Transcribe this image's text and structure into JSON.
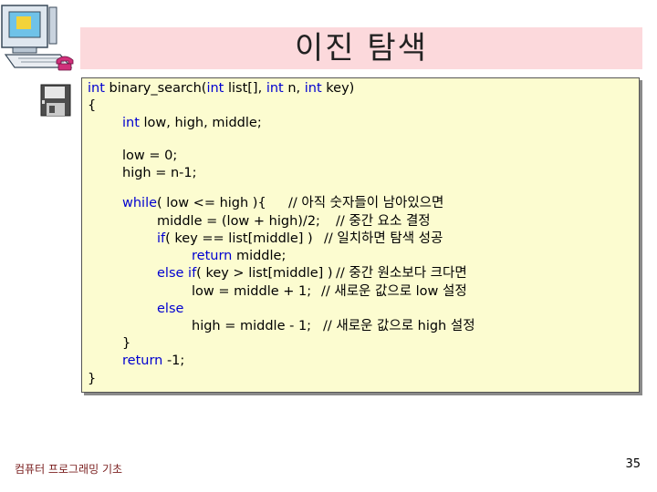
{
  "slide": {
    "title": "이진 탐색",
    "footer": "컴퓨터 프로그래밍 기초",
    "page_number": "35",
    "accent_color": "#fcd9dc",
    "code_bg_color": "#fcfcd0"
  },
  "icons": [
    "computer-icon",
    "phone-icon",
    "floppy-disk-icon"
  ],
  "code": {
    "l1_kw1": "int",
    "l1_a": " binary_search(",
    "l1_kw2": "int",
    "l1_b": " list[], ",
    "l1_kw3": "int",
    "l1_c": " n, ",
    "l1_kw4": "int",
    "l1_d": " key)",
    "l2": "{",
    "l3_kw": "int",
    "l3_a": " low, high, middle;",
    "l4": "low = 0;",
    "l5": "high = n-1;",
    "l6_kw": "while",
    "l6_a": "( low <= high ){",
    "l6_c": "// 아직 숫자들이 남아있으면",
    "l7_a": "middle = (low + high)/2;",
    "l7_c": "// 중간 요소 결정",
    "l8_kw": "if",
    "l8_a": "( key == list[middle] )",
    "l8_c": "// 일치하면 탐색 성공",
    "l9_kw": "return",
    "l9_a": " middle;",
    "l10_kw1": "else if",
    "l10_a": "( key > list[middle] )",
    "l10_c": "// 중간 원소보다 크다면",
    "l11_a": "low = middle + 1;",
    "l11_c": "// 새로운 값으로 low 설정",
    "l12_kw": "else",
    "l13_a": "high = middle - 1;",
    "l13_c": "// 새로운 값으로 high 설정",
    "l14": "}",
    "l15_kw": "return",
    "l15_a": " -1;",
    "l16": "}"
  }
}
